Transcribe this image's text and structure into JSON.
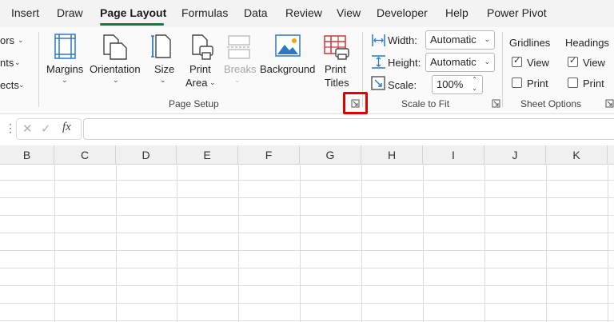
{
  "menu": {
    "tabs": [
      "Insert",
      "Draw",
      "Page Layout",
      "Formulas",
      "Data",
      "Review",
      "View",
      "Developer",
      "Help",
      "Power Pivot"
    ],
    "active": "Page Layout"
  },
  "ribbon": {
    "themes_partial": [
      "ors",
      "nts",
      "ects"
    ],
    "page_setup": {
      "margins": "Margins",
      "orientation": "Orientation",
      "size": "Size",
      "print_area_line1": "Print",
      "print_area_line2": "Area",
      "breaks": "Breaks",
      "background": "Background",
      "print_titles_line1": "Print",
      "print_titles_line2": "Titles",
      "group_label": "Page Setup"
    },
    "scale_to_fit": {
      "width_label": "Width:",
      "width_value": "Automatic",
      "height_label": "Height:",
      "height_value": "Automatic",
      "scale_label": "Scale:",
      "scale_value": "100%",
      "group_label": "Scale to Fit"
    },
    "sheet_options": {
      "gridlines": "Gridlines",
      "headings": "Headings",
      "view": "View",
      "print": "Print",
      "group_label": "Sheet Options"
    }
  },
  "formula_bar": {
    "fx": "fx",
    "value": ""
  },
  "grid": {
    "columns": [
      "B",
      "C",
      "D",
      "E",
      "F",
      "G",
      "H",
      "I",
      "J",
      "K"
    ]
  },
  "colors": {
    "accent": "#107c41",
    "highlight": "#e00000",
    "icon_blue": "#2b79c2",
    "icon_red": "#d13438"
  }
}
